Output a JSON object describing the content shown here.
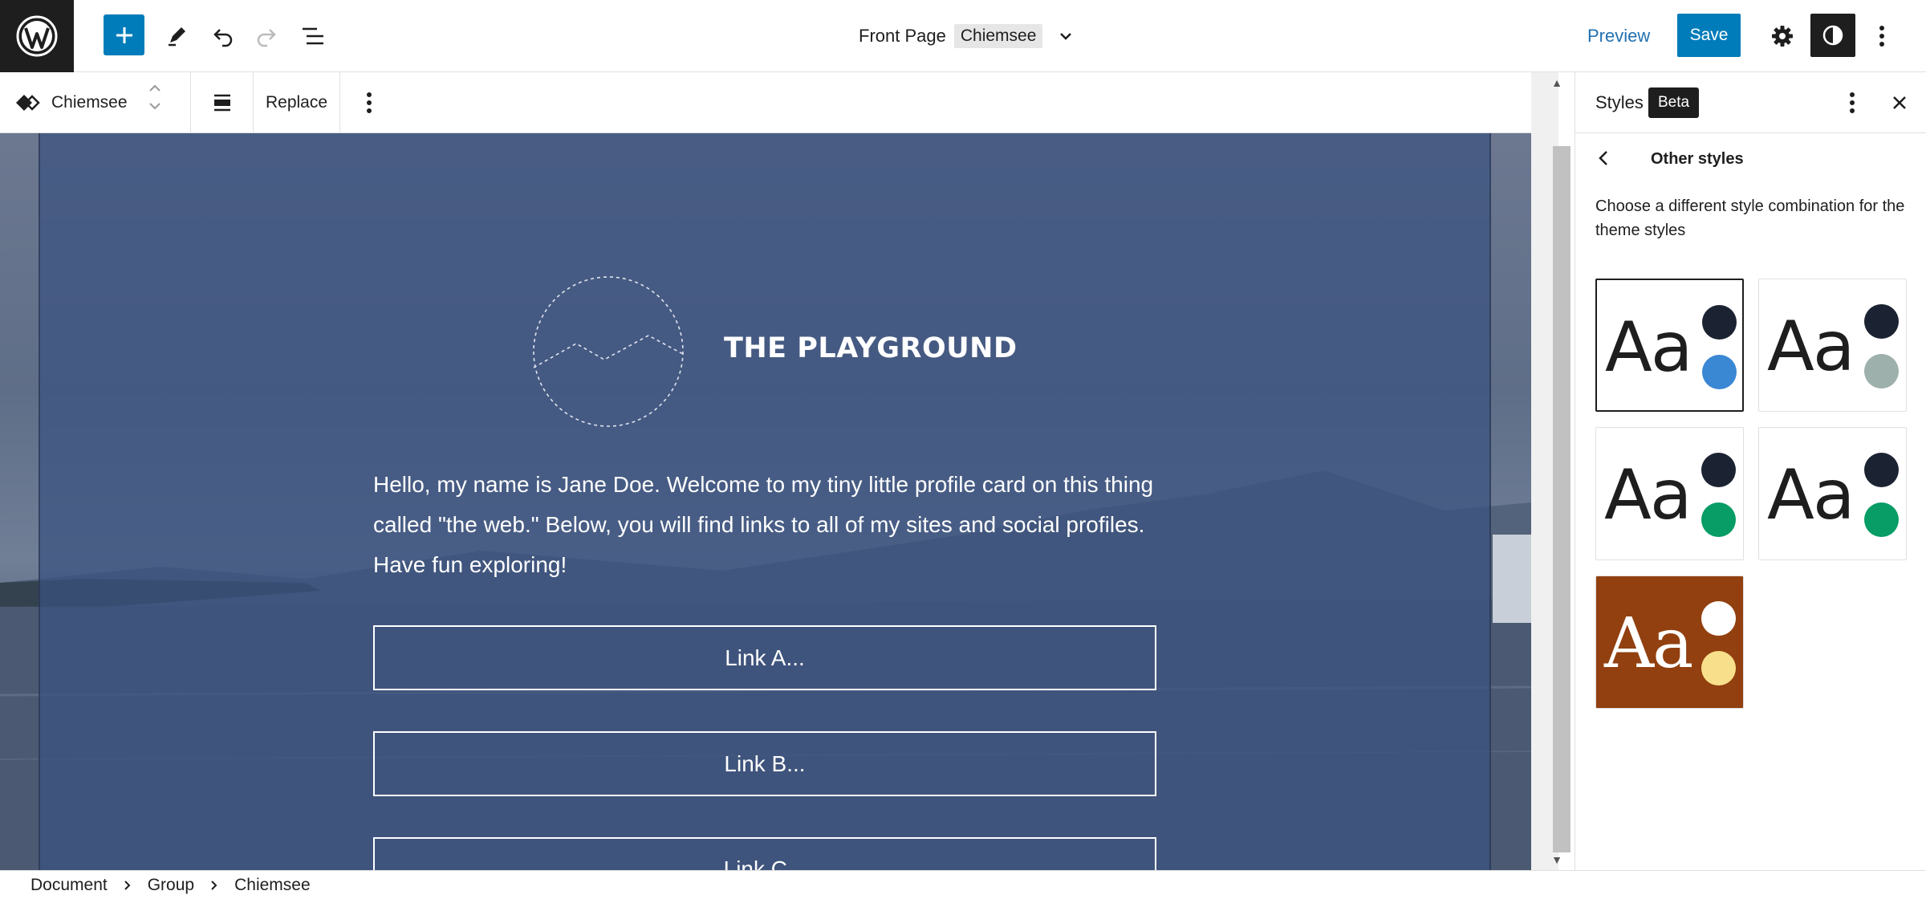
{
  "header": {
    "doc_title": "Front Page",
    "template_badge": "Chiemsee",
    "preview_label": "Preview",
    "save_label": "Save"
  },
  "block_toolbar": {
    "block_name": "Chiemsee",
    "replace_label": "Replace"
  },
  "canvas": {
    "site_title": "THE PLAYGROUND",
    "intro_text": "Hello, my name is Jane Doe.  Welcome to my tiny little profile card on this thing called \"the web.\"  Below, you will find links to all of my sites and social profiles. Have fun exploring!",
    "links": [
      "Link A...",
      "Link B...",
      "Link C..."
    ]
  },
  "sidebar": {
    "title": "Styles",
    "badge": "Beta",
    "subtitle": "Other styles",
    "description": "Choose a different style combination for the theme styles",
    "variations": [
      {
        "sample": "Aa",
        "bg": "#ffffff",
        "text_color": "#1e1e1e",
        "color1": "#1b2232",
        "color2": "#3a87d4",
        "selected": true
      },
      {
        "sample": "Aa",
        "bg": "#ffffff",
        "text_color": "#1e1e1e",
        "color1": "#1b2232",
        "color2": "#9eb0ac",
        "selected": false
      },
      {
        "sample": "Aa",
        "bg": "#ffffff",
        "text_color": "#1e1e1e",
        "color1": "#1b2232",
        "color2": "#089c66",
        "selected": false
      },
      {
        "sample": "Aa",
        "bg": "#ffffff",
        "text_color": "#1e1e1e",
        "color1": "#1b2232",
        "color2": "#089c66",
        "selected": false
      },
      {
        "sample": "Aa",
        "bg": "#924010",
        "text_color": "#ffffff",
        "color1": "#ffffff",
        "color2": "#f8df8c",
        "selected": false
      }
    ]
  },
  "breadcrumbs": [
    "Document",
    "Group",
    "Chiemsee"
  ],
  "colors": {
    "accent": "#007cba",
    "preview_link": "#2271b1",
    "dark": "#1e1e1e"
  },
  "icons": {
    "logo": "wordpress-icon",
    "add": "plus-icon",
    "tools": "pencil-icon",
    "undo": "undo-icon",
    "redo": "redo-icon",
    "list_view": "list-view-icon",
    "settings": "gear-icon",
    "styles": "contrast-icon",
    "options": "more-vertical-icon"
  }
}
